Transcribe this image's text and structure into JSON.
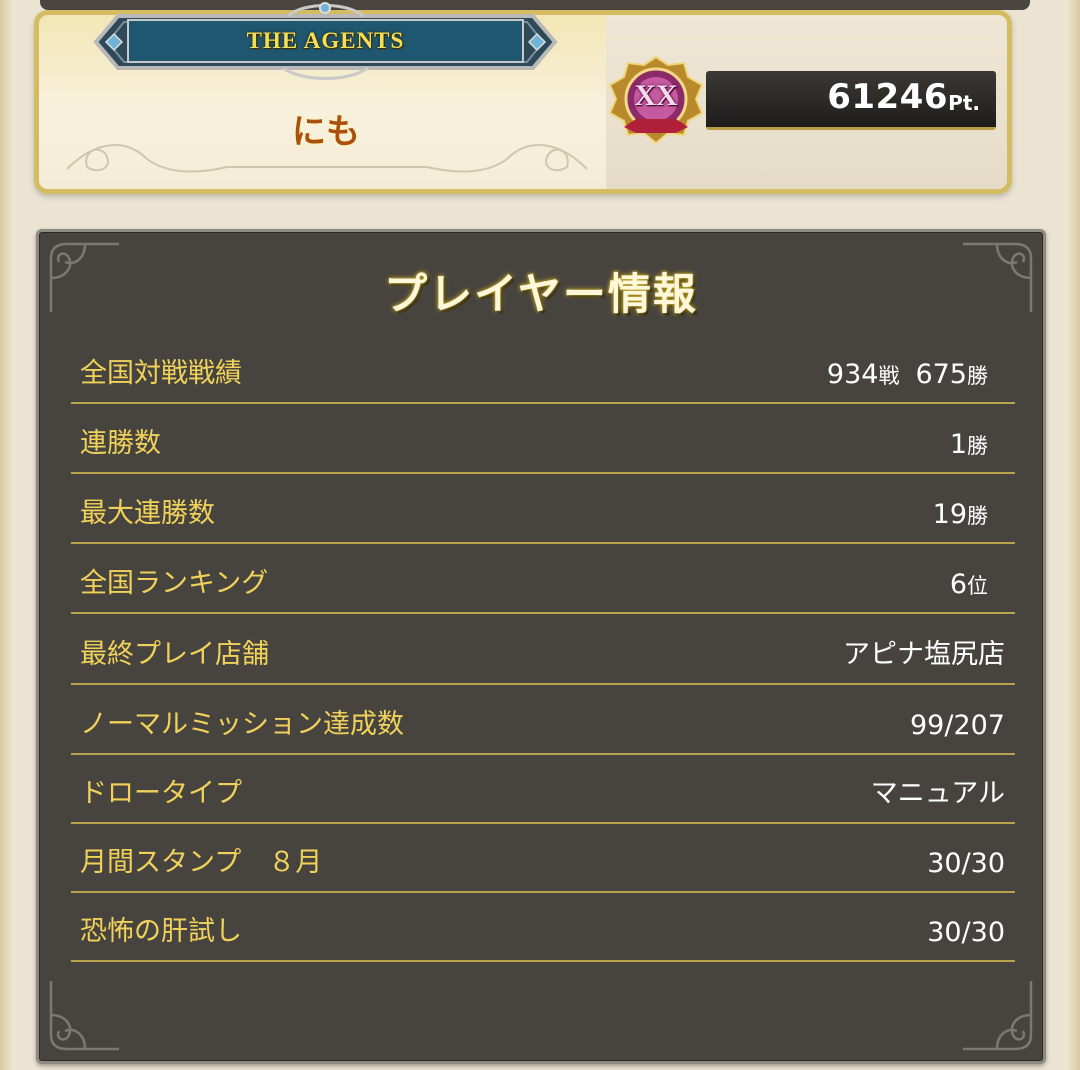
{
  "header": {
    "title_plate": "THE AGENTS",
    "player_name": "にも",
    "rank_emblem": "XX",
    "points_value": "61246",
    "points_unit": "Pt."
  },
  "panel": {
    "title": "プレイヤー情報",
    "rows": [
      {
        "label": "全国対戦戦績",
        "value_a": "934",
        "unit_a": "戦",
        "value_b": "675",
        "unit_b": "勝"
      },
      {
        "label": "連勝数",
        "value": "1",
        "unit": "勝"
      },
      {
        "label": "最大連勝数",
        "value": "19",
        "unit": "勝"
      },
      {
        "label": "全国ランキング",
        "value": "6",
        "unit": "位"
      },
      {
        "label": "最終プレイ店舗",
        "value": "アピナ塩尻店"
      },
      {
        "label": "ノーマルミッション達成数",
        "value": "99/207"
      },
      {
        "label": "ドロータイプ",
        "value": "マニュアル"
      },
      {
        "label": "月間スタンプ　８月",
        "value": "30/30"
      },
      {
        "label": "恐怖の肝試し",
        "value": "30/30"
      }
    ]
  },
  "colors": {
    "panel_background": "#474440",
    "label_gold": "#f0d25a",
    "divider_gold": "#b9a44e",
    "player_name": "#a94f0f",
    "title_plate_text": "#f1df55"
  }
}
